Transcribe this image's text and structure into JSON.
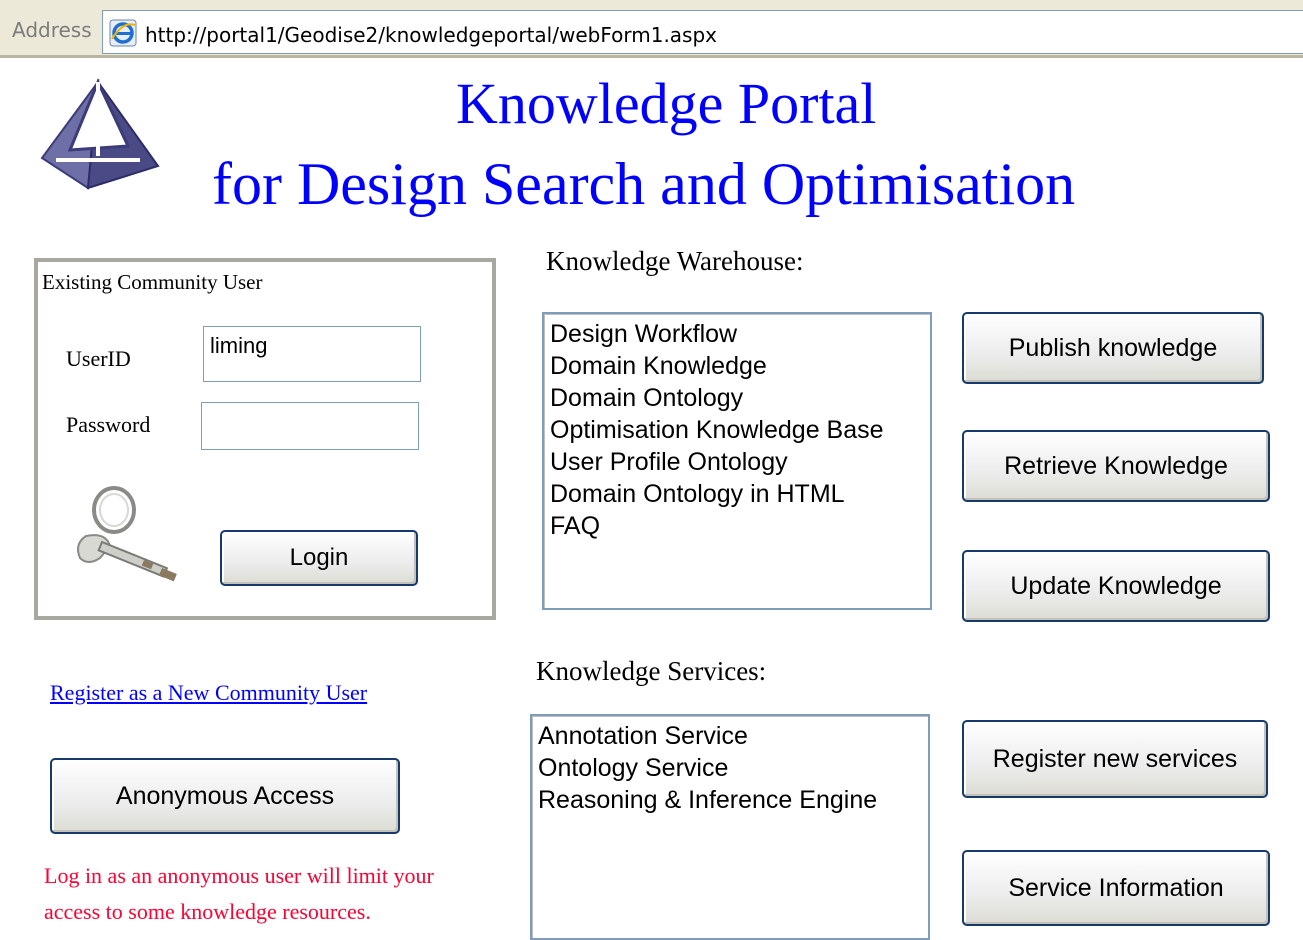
{
  "address_bar": {
    "label": "Address",
    "url": "http://portal1/Geodise2/knowledgeportal/webForm1.aspx"
  },
  "header": {
    "title_line1": "Knowledge Portal",
    "title_line2": "for Design Search and Optimisation"
  },
  "login": {
    "legend": "Existing Community User",
    "userid_label": "UserID",
    "userid_value": "liming",
    "password_label": "Password",
    "password_value": "",
    "login_label": "Login"
  },
  "register_link": "Register as a New Community User",
  "anonymous": {
    "button_label": "Anonymous Access",
    "notice_line1": "Log in as an anonymous user will limit your",
    "notice_line2": "access to some knowledge resources."
  },
  "warehouse": {
    "label": "Knowledge Warehouse:",
    "items": [
      "Design Workflow",
      "Domain Knowledge",
      "Domain Ontology",
      "Optimisation Knowledge Base",
      "User Profile Ontology",
      "Domain Ontology in HTML",
      "FAQ"
    ],
    "publish_label": "Publish knowledge",
    "retrieve_label": "Retrieve Knowledge",
    "update_label": "Update Knowledge"
  },
  "services": {
    "label": "Knowledge Services:",
    "items": [
      "Annotation Service",
      "Ontology Service",
      "Reasoning & Inference Engine"
    ],
    "register_label": "Register new services",
    "info_label": "Service Information"
  },
  "icons": {
    "logo": "tetrahedron-logo-icon",
    "browser": "internet-explorer-icon",
    "keys": "keys-icon"
  },
  "colors": {
    "title": "#0000ff",
    "link": "#0000ff",
    "notice": "#ff0033",
    "button_border": "#163a6c"
  }
}
